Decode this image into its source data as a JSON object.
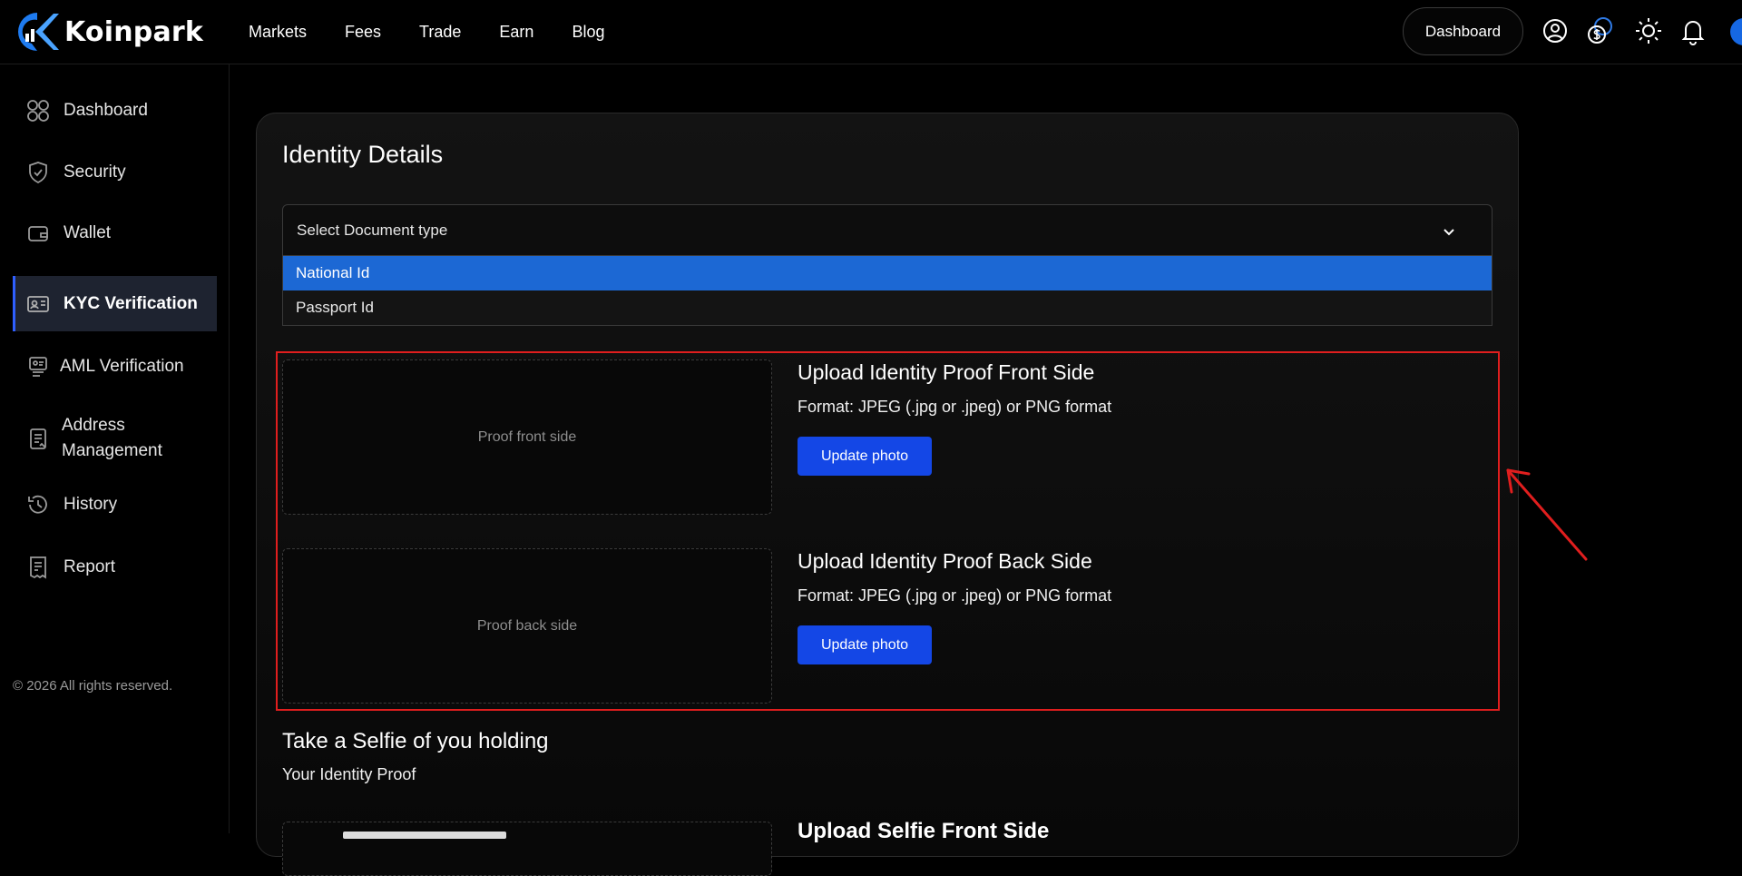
{
  "brand": {
    "name": "Koinpark",
    "accent": "#1668e3"
  },
  "nav": [
    "Markets",
    "Fees",
    "Trade",
    "Earn",
    "Blog"
  ],
  "header": {
    "dashboard_label": "Dashboard",
    "icons": [
      "user-circle-icon",
      "currency-coins-icon",
      "sun-icon",
      "bell-icon"
    ]
  },
  "sidebar": {
    "items": [
      {
        "label": "Dashboard",
        "icon": "grid-icon",
        "active": false
      },
      {
        "label": "Security",
        "icon": "shield-check-icon",
        "active": false
      },
      {
        "label": "Wallet",
        "icon": "wallet-icon",
        "active": false
      },
      {
        "label": "KYC Verification",
        "icon": "id-card-icon",
        "active": true
      },
      {
        "label": "AML Verification",
        "icon": "id-badge-icon",
        "active": false
      },
      {
        "label": "Address",
        "label2": "Management",
        "icon": "clipboard-icon",
        "active": false
      },
      {
        "label": "History",
        "icon": "history-icon",
        "active": false
      },
      {
        "label": "Report",
        "icon": "receipt-icon",
        "active": false
      }
    ],
    "copyright": "© 2026 All rights reserved."
  },
  "main": {
    "title": "Identity Details",
    "document_select": {
      "placeholder": "Select Document type",
      "options": [
        {
          "label": "National Id",
          "selected": true
        },
        {
          "label": "Passport Id",
          "selected": false
        }
      ]
    },
    "uploads": [
      {
        "placeholder": "Proof front side",
        "title": "Upload Identity Proof Front Side",
        "format": "Format: JPEG (.jpg or .jpeg) or PNG format",
        "button": "Update photo"
      },
      {
        "placeholder": "Proof back side",
        "title": "Upload Identity Proof Back Side",
        "format": "Format: JPEG (.jpg or .jpeg) or PNG format",
        "button": "Update photo"
      }
    ],
    "selfie": {
      "title": "Take a Selfie of you holding",
      "subtitle": "Your Identity Proof",
      "upload_title": "Upload Selfie Front Side"
    }
  },
  "colors": {
    "button": "#1447e6",
    "highlight": "#e01e1e",
    "selected_option": "#1c68d4"
  }
}
